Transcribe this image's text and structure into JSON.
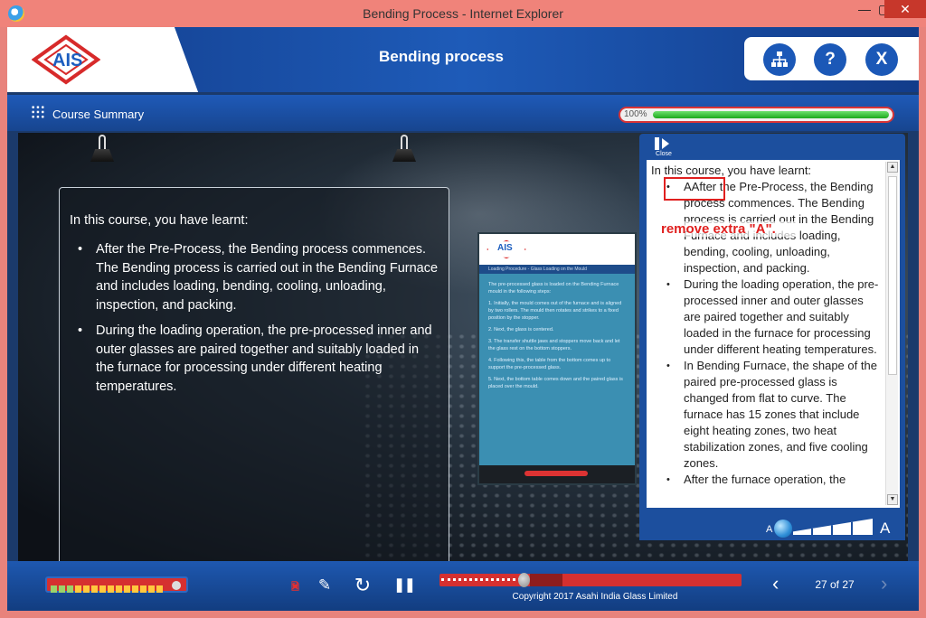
{
  "window": {
    "title": "Bending Process - Internet Explorer",
    "minimize": "—",
    "maximize": "▢",
    "close": "✕"
  },
  "header": {
    "logo_text": "AIS",
    "title": "Bending process",
    "tools": [
      {
        "name": "sitemap",
        "icon": "sitemap-icon",
        "glyph": "⊞"
      },
      {
        "name": "help",
        "icon": "question-icon",
        "glyph": "?"
      },
      {
        "name": "exit",
        "icon": "close-icon",
        "glyph": "X"
      }
    ]
  },
  "subbar": {
    "course_summary": "Course Summary",
    "progress_label": "100%",
    "progress_value": 1.0
  },
  "summary": {
    "intro": "In this course, you have learnt:",
    "points": [
      "After the Pre-Process, the Bending process commences. The Bending process is carried out in the Bending Furnace and includes loading, bending, cooling, unloading, inspection, and packing.",
      "During the loading operation, the pre-processed inner and outer glasses are paired together and suitably loaded in the furnace for processing under different heating temperatures."
    ]
  },
  "monitor": {
    "logo": "AIS",
    "bar": "Loading Procedure - Glass Loading on the Mould",
    "lines": [
      "The pre-processed glass is loaded on the Bending Furnace mould in the following steps:",
      "1. Initially, the mould comes out of the furnace and is aligned by two rollers. The mould then rotates and strikes to a fixed position by the stopper.",
      "2. Next, the glass is centered.",
      "3. The transfer shuttle jaws and stoppers move back and let the glass rest on the bottom stoppers.",
      "4. Following this, the table from the bottom comes up to support the pre-processed glass.",
      "5. Next, the bottom table comes down and the paired glass is placed over the mould."
    ]
  },
  "transcript": {
    "close_label": "Close",
    "intro": "In this course, you have learnt:",
    "points": [
      "AAfter the Pre-Process, the Bending process commences. The Bending process is carried out in the Bending Furnace and includes loading, bending, cooling, unloading, inspection, and packing.",
      "During the loading operation, the pre-processed inner and outer glasses are paired together and suitably loaded in the furnace for processing under different heating temperatures.",
      "In Bending Furnace, the shape of the paired pre-processed glass is changed from flat to curve. The furnace has 15 zones that include eight heating zones, two heat stabilization zones, and five cooling zones.",
      "After the furnace operation, the"
    ],
    "annotation": "remove extra \"A\".",
    "font_small": "A",
    "font_large": "A",
    "font_level": 0.1
  },
  "footer": {
    "volume_level": 0.95,
    "seek_position": 0.29,
    "copyright": "Copyright 2017 Asahi India Glass Limited",
    "page": "27 of 27",
    "prev": "‹",
    "next": "›"
  },
  "colors": {
    "titlebar": "#f0837a",
    "header_blue": "#1e5bb8",
    "accent_red": "#d53030",
    "progress_green": "#1ca81c",
    "annotation_red": "#e0201f"
  }
}
